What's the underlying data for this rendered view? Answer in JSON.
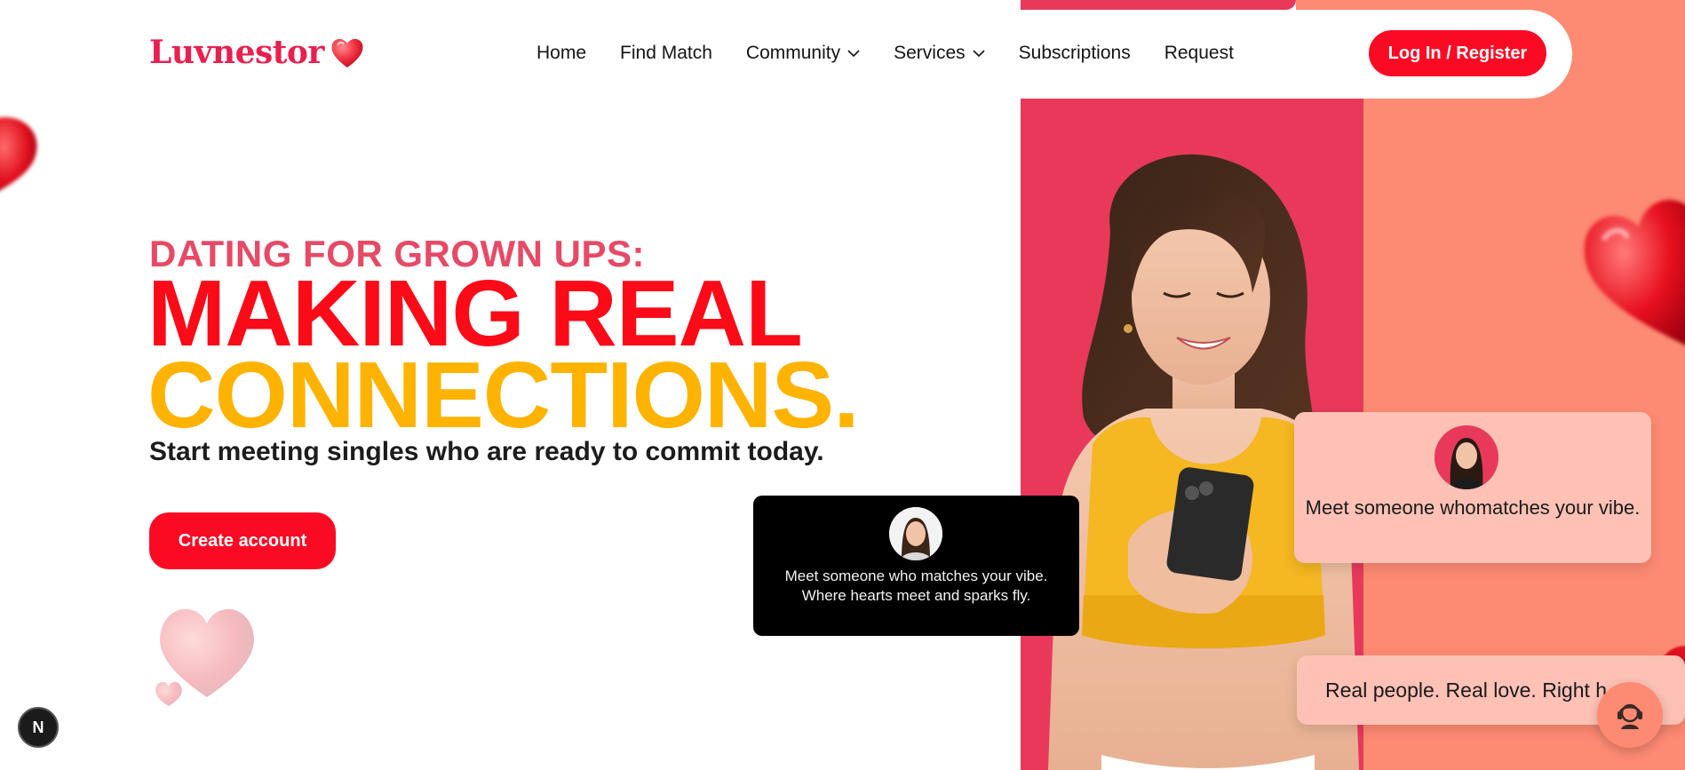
{
  "header": {
    "logo_text": "Luvnestor",
    "nav": [
      {
        "label": "Home"
      },
      {
        "label": "Find Match"
      },
      {
        "label": "Community",
        "dropdown": true
      },
      {
        "label": "Services",
        "dropdown": true
      },
      {
        "label": "Subscriptions"
      },
      {
        "label": "Request"
      }
    ],
    "login_label": "Log In / Register"
  },
  "hero": {
    "kicker": "DATING FOR GROWN UPS:",
    "headline_line1": "MAKING REAL",
    "headline_line2": "CONNECTIONS.",
    "subheadline": "Start meeting singles who are ready to commit today.",
    "cta_label": "Create account"
  },
  "cards": {
    "dark_card_text_line1": "Meet someone who matches your vibe.",
    "dark_card_text_line2": "Where hearts meet and sparks fly.",
    "pink_card_text": "Meet someone whomatches your vibe.",
    "bottom_card_text": "Real people. Real love. Right h"
  },
  "badge": {
    "next_label": "N"
  },
  "colors": {
    "brand_red": "#fb0a24",
    "accent_yellow": "#fdb300",
    "kicker_pink": "#e64a65",
    "panel_pink": "#e8395b",
    "panel_coral": "#fd8a73",
    "card_pink": "#fdc1b5"
  },
  "icons": {
    "logo_heart": "heart-icon",
    "dropdown": "chevron-down-icon",
    "support": "customer-support-icon",
    "next_badge": "nextjs-badge-icon"
  }
}
